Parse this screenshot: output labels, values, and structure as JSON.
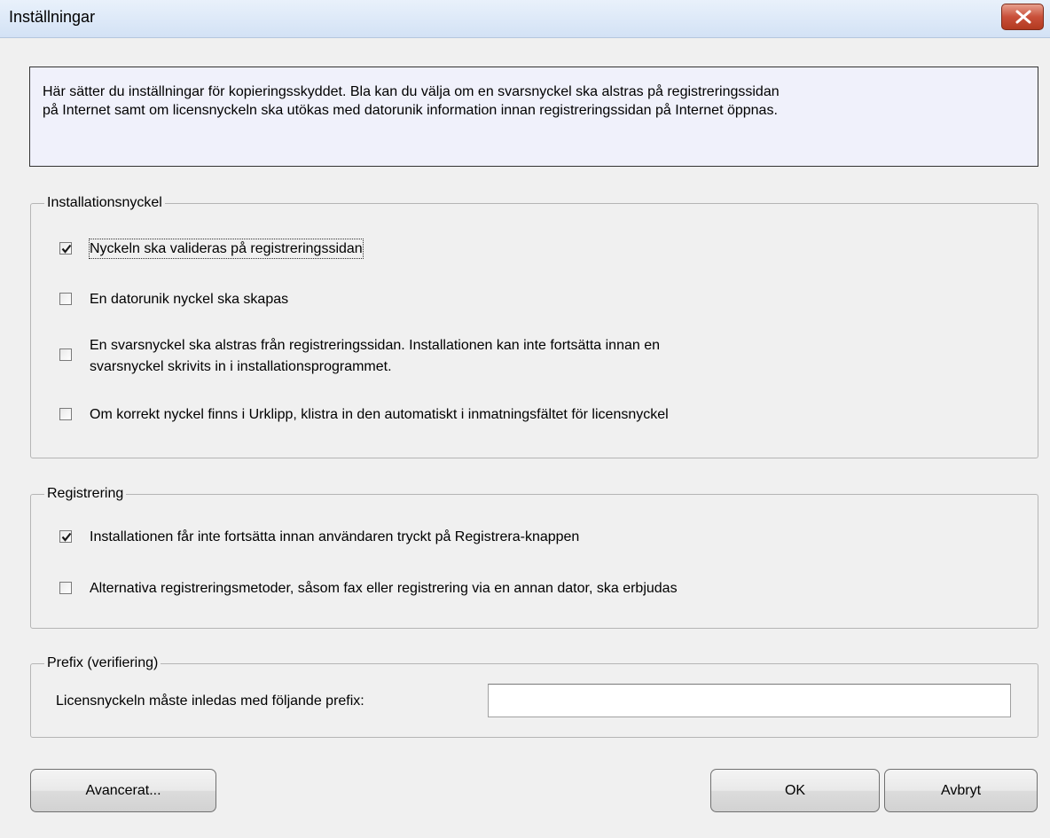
{
  "window": {
    "title": "Inställningar",
    "close_icon": "close-icon",
    "close_color": "#c9503a"
  },
  "info": {
    "text_line1": "Här sätter du inställningar för kopieringsskyddet. Bla kan du välja om en svarsnyckel ska alstras på registreringssidan",
    "text_line2": "på Internet samt om licensnyckeln ska utökas med datorunik information innan registreringssidan på Internet öppnas."
  },
  "installationsnyckel": {
    "legend": "Installationsnyckel",
    "items": [
      {
        "label": "Nyckeln ska valideras på registreringssidan",
        "checked": true
      },
      {
        "label": "En datorunik nyckel ska skapas",
        "checked": false
      },
      {
        "label_line1": "En svarsnyckel ska alstras från registreringssidan. Installationen kan inte fortsätta innan en",
        "label_line2": "svarsnyckel skrivits in i installationsprogrammet.",
        "checked": false
      },
      {
        "label": "Om korrekt nyckel finns i Urklipp, klistra in den automatiskt i inmatningsfältet för licensnyckel",
        "checked": false
      }
    ]
  },
  "registrering": {
    "legend": "Registrering",
    "items": [
      {
        "label": "Installationen får inte fortsätta innan användaren tryckt på Registrera-knappen",
        "checked": true
      },
      {
        "label": "Alternativa registreringsmetoder, såsom fax eller registrering via en annan dator, ska erbjudas",
        "checked": false
      }
    ]
  },
  "prefix": {
    "legend": "Prefix (verifiering)",
    "label": "Licensnyckeln måste inledas med följande prefix:",
    "value": ""
  },
  "buttons": {
    "advanced": "Avancerat...",
    "ok": "OK",
    "cancel": "Avbryt"
  }
}
